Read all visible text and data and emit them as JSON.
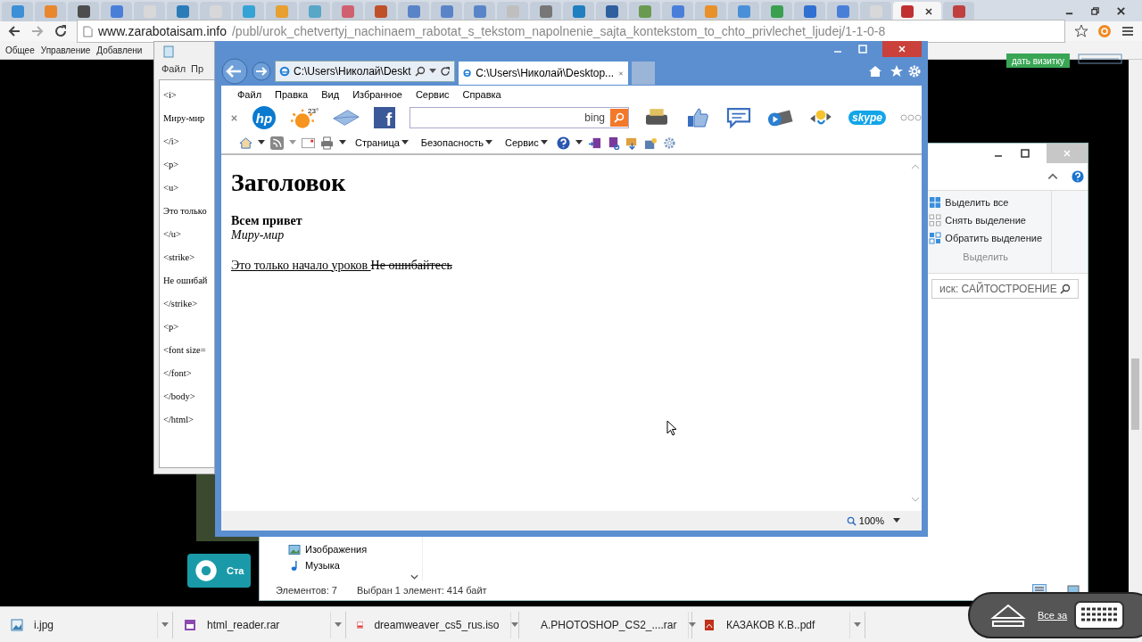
{
  "chrome": {
    "tabs": [
      {
        "color": "#3d8fd6",
        "selected": false
      },
      {
        "color": "#e8872e",
        "selected": false
      },
      {
        "color": "#4d4d4d",
        "selected": false
      },
      {
        "color": "#4a7fd9",
        "selected": false
      },
      {
        "color": "#d8d8d8",
        "selected": false
      },
      {
        "color": "#2b7bb9",
        "selected": false
      },
      {
        "color": "#d8d8d8",
        "selected": false
      },
      {
        "color": "#35a3d6",
        "selected": false
      },
      {
        "color": "#e8a030",
        "selected": false
      },
      {
        "color": "#58a6c8",
        "selected": false
      },
      {
        "color": "#d06070",
        "selected": false
      },
      {
        "color": "#c0502a",
        "selected": false
      },
      {
        "color": "#5a84c8",
        "selected": false
      },
      {
        "color": "#5a84c8",
        "selected": false
      },
      {
        "color": "#5a84c8",
        "selected": false
      },
      {
        "color": "#bfbfbf",
        "selected": false
      },
      {
        "color": "#777777",
        "selected": false
      },
      {
        "color": "#1f7fbf",
        "selected": false
      },
      {
        "color": "#2f5f9f",
        "selected": false
      },
      {
        "color": "#6a9a50",
        "selected": false
      },
      {
        "color": "#4a7fd9",
        "selected": false
      },
      {
        "color": "#e8902a",
        "selected": false
      },
      {
        "color": "#4a90d9",
        "selected": false
      },
      {
        "color": "#3aa050",
        "selected": false
      },
      {
        "color": "#3070d0",
        "selected": false
      },
      {
        "color": "#4a7fd9",
        "selected": false
      },
      {
        "color": "#d8d8d8",
        "selected": false
      },
      {
        "color": "#c03030",
        "selected": true
      },
      {
        "color": "#c04040",
        "selected": false
      }
    ],
    "url_host": "www.zarabotaisam.info",
    "url_path": "/publ/urok_chetvertyj_nachinaem_rabotat_s_tekstom_napolnenie_sajta_kontekstom_to_chto_privlechet_ljudej/1-1-0-8",
    "bookmarks": [
      "Общее",
      "Управление",
      "Добавлени"
    ],
    "promo_button": "дать визитку",
    "side_button": "Ста",
    "downloads": [
      {
        "name": "i.jpg",
        "kind": "image"
      },
      {
        "name": "html_reader.rar",
        "kind": "archive"
      },
      {
        "name": "dreamweaver_cs5_rus.iso",
        "kind": "disc"
      },
      {
        "name": "A.PHOTOSHOP_CS2_....rar",
        "kind": "archive"
      },
      {
        "name": "КАЗАКОВ К.В..pdf",
        "kind": "pdf"
      }
    ],
    "overlay_link": "Все за"
  },
  "notepad": {
    "menu": [
      "Файл",
      "Пр"
    ],
    "lines": [
      "<i>",
      "Миру-мир",
      "</i>",
      "<p>",
      "<u>",
      "Это только",
      "</u>",
      "<strike>",
      "Не ошибай",
      "</strike>",
      "<p>",
      "<font size=",
      "</font>",
      "</body>",
      "</html>"
    ]
  },
  "explorer": {
    "ribbon_items": [
      {
        "label": "Выделить все",
        "kind": "select-all"
      },
      {
        "label": "Снять выделение",
        "kind": "select-none"
      },
      {
        "label": "Обратить выделение",
        "kind": "invert"
      }
    ],
    "ribbon_group": "Выделить",
    "search_placeholder": "иск: САЙТОСТРОЕНИЕ",
    "nav_items": [
      {
        "label": "Изображения",
        "kind": "pictures"
      },
      {
        "label": "Музыка",
        "kind": "music"
      }
    ],
    "status_count": "Элементов: 7",
    "status_selection": "Выбран 1 элемент: 414 байт"
  },
  "ie": {
    "address": "C:\\Users\\Николай\\Deskt",
    "tab_title": "C:\\Users\\Николай\\Desktop...",
    "menu": [
      "Файл",
      "Правка",
      "Вид",
      "Избранное",
      "Сервис",
      "Справка"
    ],
    "quick_links": [
      {
        "kind": "hp",
        "label": "hp"
      },
      {
        "kind": "weather",
        "label": "23°"
      },
      {
        "kind": "mail"
      },
      {
        "kind": "facebook",
        "label": "f"
      }
    ],
    "search_engine": "bing",
    "apps": [
      {
        "kind": "printer"
      },
      {
        "kind": "like"
      },
      {
        "kind": "chat"
      },
      {
        "kind": "video"
      },
      {
        "kind": "translate"
      },
      {
        "kind": "skype",
        "label": "skype"
      },
      {
        "kind": "more"
      }
    ],
    "command_menus": [
      "Страница",
      "Безопасность",
      "Сервис"
    ],
    "page": {
      "heading": "Заголовок",
      "bold_line": "Всем привет",
      "italic_line": "Миру-мир",
      "underlined_text": "Это только начало уроков ",
      "struck_text": "Не ошибайтесь"
    },
    "zoom": "100%"
  }
}
